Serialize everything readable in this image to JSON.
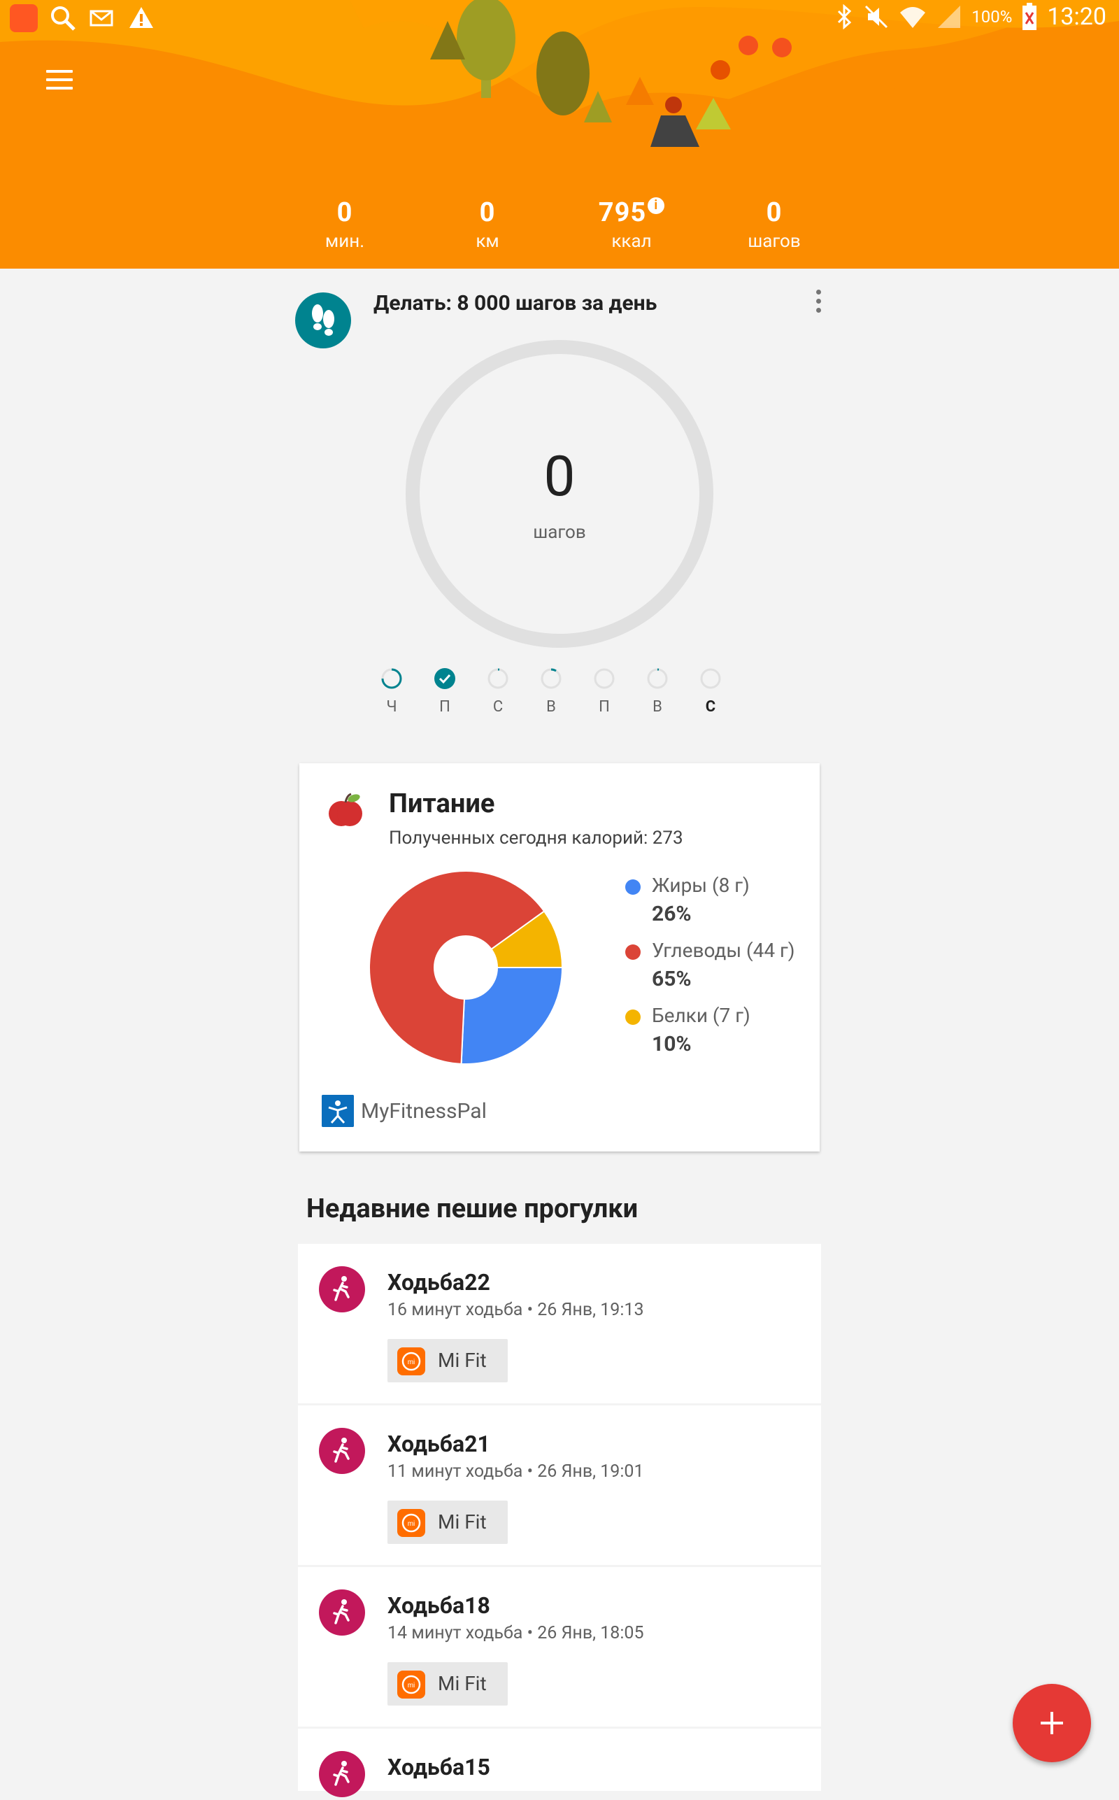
{
  "status_bar": {
    "battery_text": "100%",
    "time": "13:20"
  },
  "summary": [
    {
      "value": "0",
      "unit": "мин."
    },
    {
      "value": "0",
      "unit": "км"
    },
    {
      "value": "795",
      "unit": "ккал",
      "info_icon": true
    },
    {
      "value": "0",
      "unit": "шагов"
    }
  ],
  "goal": {
    "title": "Делать: 8 000 шагов за день",
    "steps_value": "0",
    "steps_unit": "шагов",
    "progress": 0,
    "days": [
      {
        "label": "Ч",
        "state": "partial"
      },
      {
        "label": "П",
        "state": "done"
      },
      {
        "label": "С",
        "state": "tiny"
      },
      {
        "label": "В",
        "state": "tiny"
      },
      {
        "label": "П",
        "state": "empty"
      },
      {
        "label": "В",
        "state": "tiny"
      },
      {
        "label": "С",
        "state": "empty",
        "today": true
      }
    ]
  },
  "nutrition": {
    "title": "Питание",
    "subtitle": "Полученных сегодня калорий: 273",
    "source": "MyFitnessPal",
    "colors": {
      "fat": "#4285f4",
      "carbs": "#db4437",
      "protein": "#f4b400"
    },
    "items": [
      {
        "name": "Жиры (8 г)",
        "percent_label": "26%",
        "percent": 26,
        "color": "#4285f4"
      },
      {
        "name": "Углеводы (44 г)",
        "percent_label": "65%",
        "percent": 65,
        "color": "#db4437"
      },
      {
        "name": "Белки (7 г)",
        "percent_label": "10%",
        "percent": 10,
        "color": "#f4b400"
      }
    ]
  },
  "recent": {
    "title": "Недавние пешие прогулки",
    "walks": [
      {
        "title": "Ходьба22",
        "subtitle": "16 минут ходьба • 26 Янв, 19:13",
        "source": "Mi Fit"
      },
      {
        "title": "Ходьба21",
        "subtitle": "11 минут ходьба • 26 Янв, 19:01",
        "source": "Mi Fit"
      },
      {
        "title": "Ходьба18",
        "subtitle": "14 минут ходьба • 26 Янв, 18:05",
        "source": "Mi Fit"
      },
      {
        "title": "Ходьба15",
        "subtitle": "",
        "source": ""
      }
    ]
  },
  "fab_icon": "plus-icon"
}
